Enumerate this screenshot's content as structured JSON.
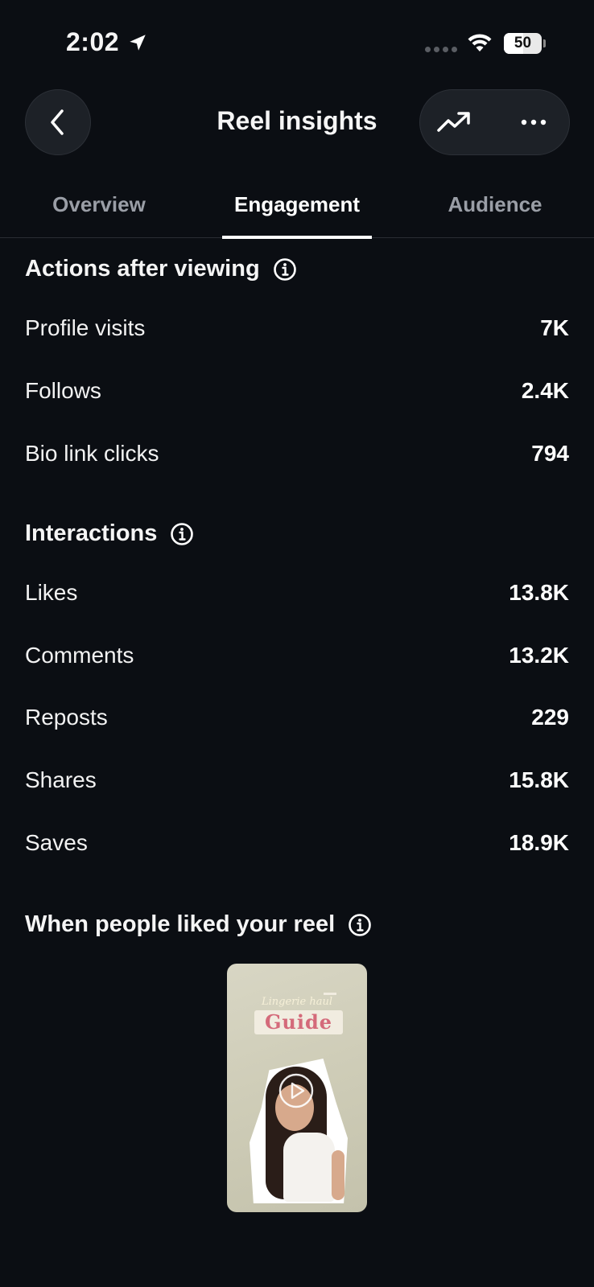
{
  "status_bar": {
    "time": "2:02",
    "battery": "50",
    "battery_level": 0.5
  },
  "header": {
    "title": "Reel insights"
  },
  "tabs": [
    {
      "label": "Overview",
      "active": false
    },
    {
      "label": "Engagement",
      "active": true
    },
    {
      "label": "Audience",
      "active": false
    }
  ],
  "actions_after_viewing": {
    "title": "Actions after viewing",
    "rows": [
      {
        "label": "Profile visits",
        "value": "7K"
      },
      {
        "label": "Follows",
        "value": "2.4K"
      },
      {
        "label": "Bio link clicks",
        "value": "794"
      }
    ]
  },
  "interactions": {
    "title": "Interactions",
    "rows": [
      {
        "label": "Likes",
        "value": "13.8K"
      },
      {
        "label": "Comments",
        "value": "13.2K"
      },
      {
        "label": "Reposts",
        "value": "229"
      },
      {
        "label": "Shares",
        "value": "15.8K"
      },
      {
        "label": "Saves",
        "value": "18.9K"
      }
    ]
  },
  "likes_timing": {
    "title": "When people liked your reel",
    "thumbnail": {
      "subtitle": "Lingerie haul",
      "title": "Guide"
    }
  },
  "icons": {
    "location": "location-arrow-icon",
    "wifi": "wifi-icon",
    "back": "chevron-left-icon",
    "trend": "trending-up-icon",
    "more": "more-horizontal-icon",
    "info": "info-icon",
    "play": "play-icon"
  },
  "colors": {
    "background": "#0b0e13",
    "button": "#1d2127",
    "muted_text": "#9a9ea6",
    "text": "#ffffff"
  }
}
